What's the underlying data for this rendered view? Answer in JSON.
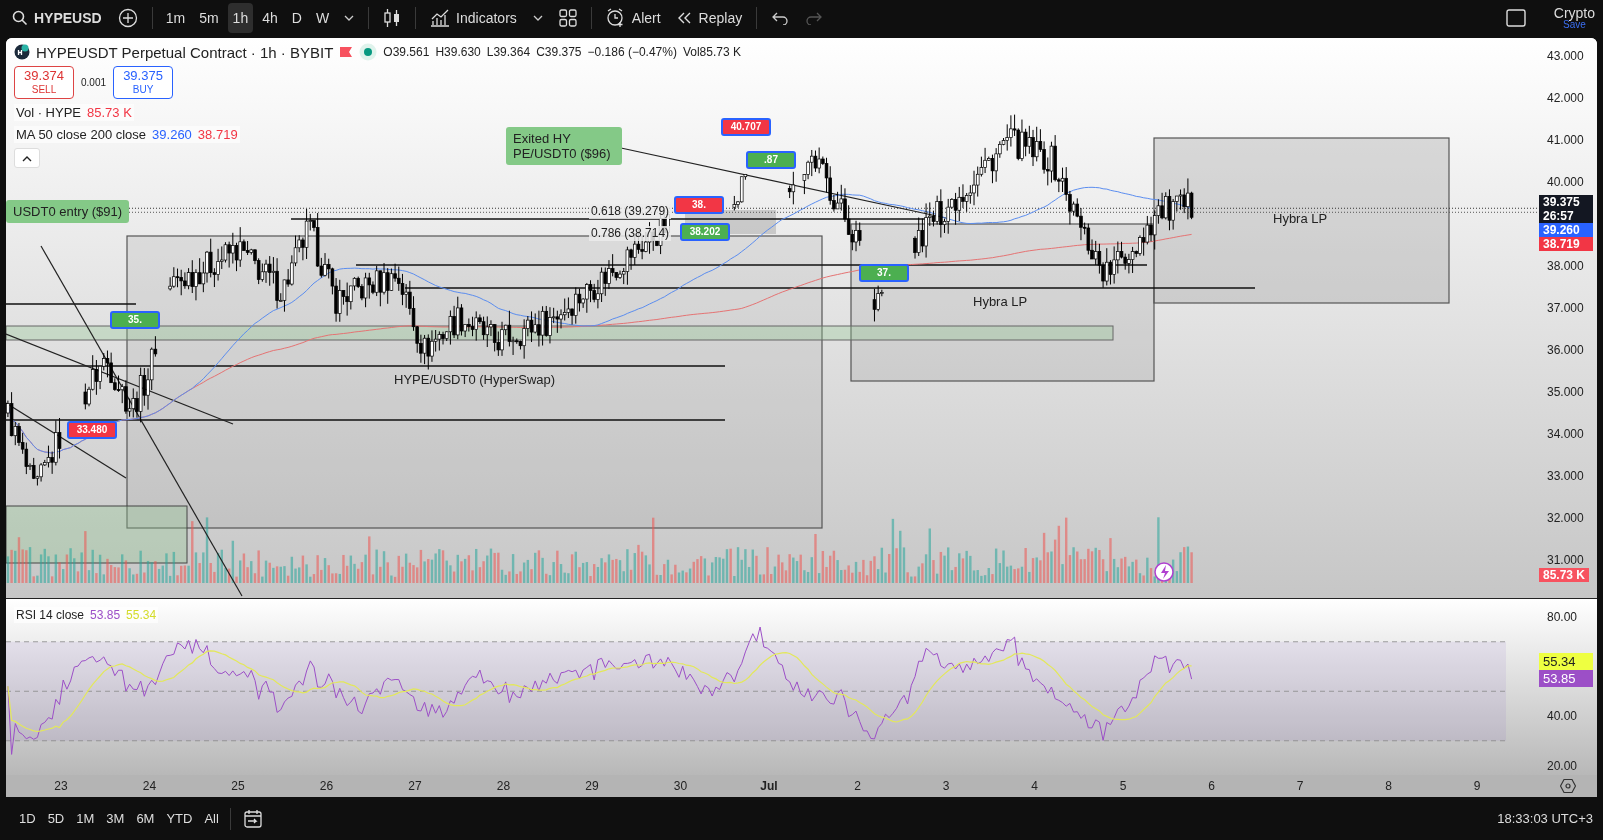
{
  "topbar": {
    "symbol": "HYPEUSD",
    "intervals": [
      {
        "label": "1m",
        "selected": false
      },
      {
        "label": "5m",
        "selected": false
      },
      {
        "label": "1h",
        "selected": true
      },
      {
        "label": "4h",
        "selected": false
      },
      {
        "label": "D",
        "selected": false
      },
      {
        "label": "W",
        "selected": false
      }
    ],
    "indicators_label": "Indicators",
    "alert_label": "Alert",
    "replay_label": "Replay",
    "history": [
      {
        "kind": "undo",
        "disabled": false
      },
      {
        "kind": "redo",
        "disabled": true
      }
    ],
    "layout": {
      "name": "Crypto",
      "action": "Save"
    }
  },
  "legend": {
    "title": "HYPEUSDT Perpetual Contract · 1h · BYBIT",
    "market_open": true,
    "ohlc": [
      "O39.561",
      "H39.630",
      "L39.364",
      "C39.375",
      "−0.186 (−0.47%)",
      "Vol85.73 K"
    ],
    "sell": {
      "price": "39.374",
      "label": "SELL"
    },
    "spread": "0.001",
    "buy": {
      "price": "39.375",
      "label": "BUY"
    },
    "indicators": [
      {
        "name": "Vol · HYPE",
        "values": [
          {
            "text": "85.73 K",
            "color": "#f23645"
          }
        ]
      },
      {
        "name": "MA 50 close 200 close",
        "values": [
          {
            "text": "39.260",
            "color": "#2962ff"
          },
          {
            "text": "38.719",
            "color": "#f23645"
          }
        ]
      }
    ]
  },
  "annotations": {
    "callouts": [
      {
        "lines": [
          "USDT0 entry ($91)"
        ]
      },
      {
        "lines": [
          "Exited HY",
          "PE/USDT0 ($96)"
        ]
      }
    ],
    "fib_levels": [
      "0.618 (39.279)",
      "0.786 (38.714)"
    ],
    "zone_labels": [
      "HYPE/USDT0 (HyperSwap)",
      "Hybra LP",
      "Hybra LP"
    ],
    "trade_markers": [
      {
        "kind": "buy",
        "label": "35."
      },
      {
        "kind": "sell",
        "label": "33.480"
      },
      {
        "kind": "sell",
        "label": "38."
      },
      {
        "kind": "buy",
        "label": "38.202"
      },
      {
        "kind": "sell",
        "label": "40.707"
      },
      {
        "kind": "buy",
        "label": ".87"
      },
      {
        "kind": "buy",
        "label": "37."
      }
    ]
  },
  "price_axis": {
    "labels": [
      "43.000",
      "42.000",
      "41.000",
      "40.000",
      "38.000",
      "37.000",
      "36.000",
      "35.000",
      "34.000",
      "33.000",
      "32.000",
      "31.000"
    ],
    "badges": [
      {
        "text": "39.375",
        "countdown": "26:57",
        "color": "#131722"
      },
      {
        "text": "39.260",
        "color": "#2962ff"
      },
      {
        "text": "38.719",
        "color": "#f23645"
      }
    ],
    "volume_badge": {
      "text": "85.73 K",
      "color": "#f7525f"
    }
  },
  "rsi": {
    "legend": "RSI 14 close",
    "values": [
      {
        "text": "53.85",
        "color": "#9c4fc7"
      },
      {
        "text": "55.34",
        "color": "#d4dc2a"
      }
    ],
    "axis_labels": [
      "80.00",
      "40.00",
      "20.00"
    ],
    "badges": [
      {
        "text": "55.34",
        "color": "#eeff41"
      },
      {
        "text": "53.85",
        "color": "#9c4fc7"
      }
    ]
  },
  "time_axis": [
    "23",
    "24",
    "25",
    "26",
    "27",
    "28",
    "29",
    "30",
    "Jul",
    "2",
    "3",
    "4",
    "5",
    "6",
    "7",
    "8",
    "9"
  ],
  "bottombar": {
    "ranges": [
      "1D",
      "5D",
      "1M",
      "3M",
      "6M",
      "YTD",
      "All"
    ],
    "clock": "18:33:03 UTC+3"
  }
}
